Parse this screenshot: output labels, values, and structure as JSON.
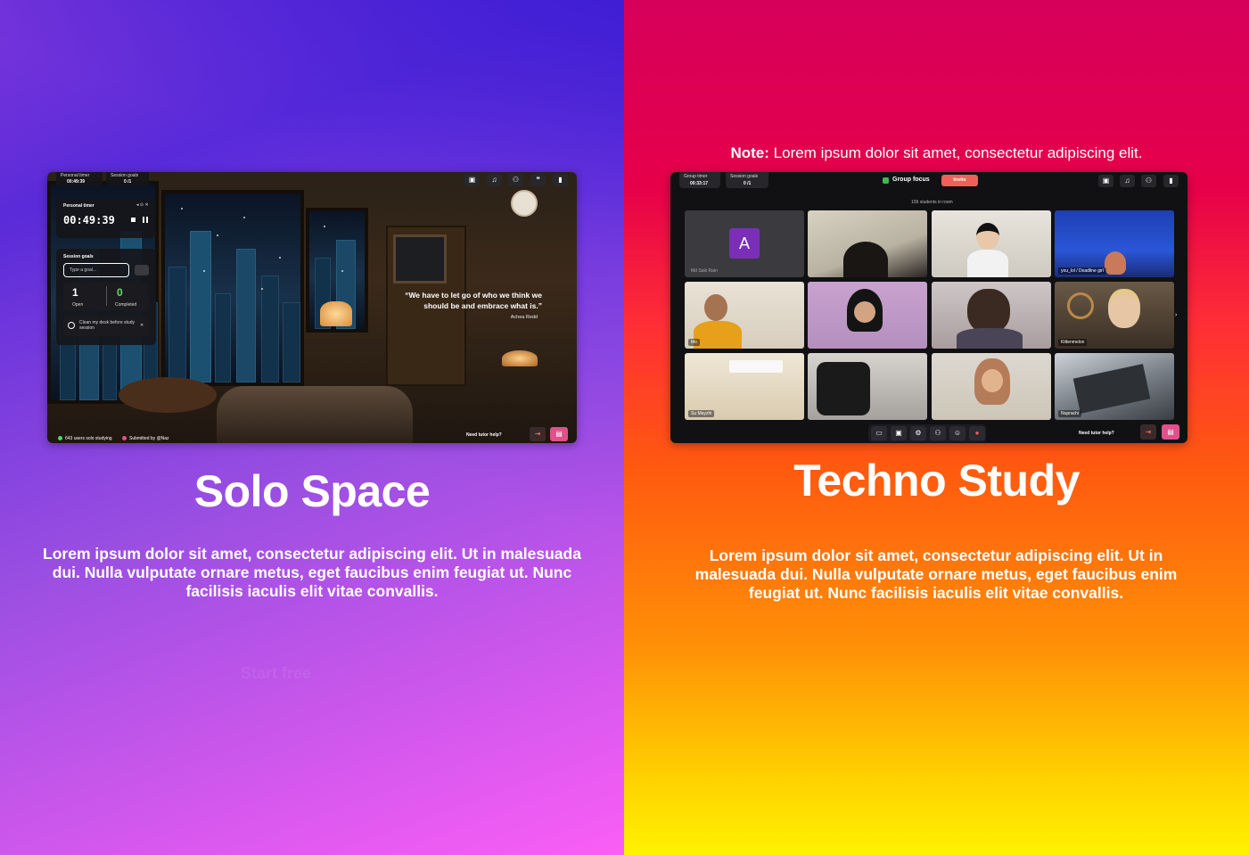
{
  "solo": {
    "title": "Solo Space",
    "description": "Lorem ipsum dolor sit amet, consectetur adipiscing elit. Ut in malesuada dui. Nulla vulputate ornare metus, eget faucibus enim feugiat ut. Nunc facilisis iaculis elit vitae convallis.",
    "ghost_text": "Start free",
    "screenshot": {
      "top_pills": [
        {
          "label": "Personal timer",
          "value": "00:49:39"
        },
        {
          "label": "Session goals",
          "value": "0 /1"
        }
      ],
      "timer_card": {
        "title": "Personal timer",
        "time": "00:49:39"
      },
      "goals_card": {
        "title": "Session goals",
        "placeholder": "Type a goal...",
        "open_count": "1",
        "open_label": "Open",
        "completed_count": "0",
        "completed_label": "Completed",
        "task": "Clean my desk before study session"
      },
      "quote": "“We have to let go of who we think we should be and embrace what is.”",
      "quote_author": "Achea Redd",
      "footer_left": "643 users solo studying",
      "footer_submitted": "Submitted by @Naz",
      "help": "Need tutor help?"
    }
  },
  "techno": {
    "note_label": "Note:",
    "note_text": "Lorem ipsum dolor sit amet, consectetur adipiscing elit.",
    "title": "Techno Study",
    "description": "Lorem ipsum dolor sit amet, consectetur adipiscing elit. Ut in malesuada dui. Nulla vulputate ornare metus, eget faucibus enim feugiat ut. Nunc facilisis iaculis elit vitae convallis.",
    "screenshot": {
      "top_pills": [
        {
          "label": "Group timer",
          "value": "00:33:17"
        },
        {
          "label": "Session goals",
          "value": "0 /1"
        }
      ],
      "room_title": "Group focus",
      "invite": "Invite",
      "students_in_room": "109 students in room",
      "avatar_letter": "A",
      "tiles": [
        {
          "name": "Md Saki Rain"
        },
        {
          "name": ""
        },
        {
          "name": ""
        },
        {
          "name": "you_lol / Deadline girl"
        },
        {
          "name": "Mo"
        },
        {
          "name": ""
        },
        {
          "name": ""
        },
        {
          "name": "Kittenmelon"
        },
        {
          "name": "Su Mayzhi"
        },
        {
          "name": ""
        },
        {
          "name": ""
        },
        {
          "name": "Nuprachi"
        }
      ],
      "help": "Need tutor help?"
    }
  }
}
